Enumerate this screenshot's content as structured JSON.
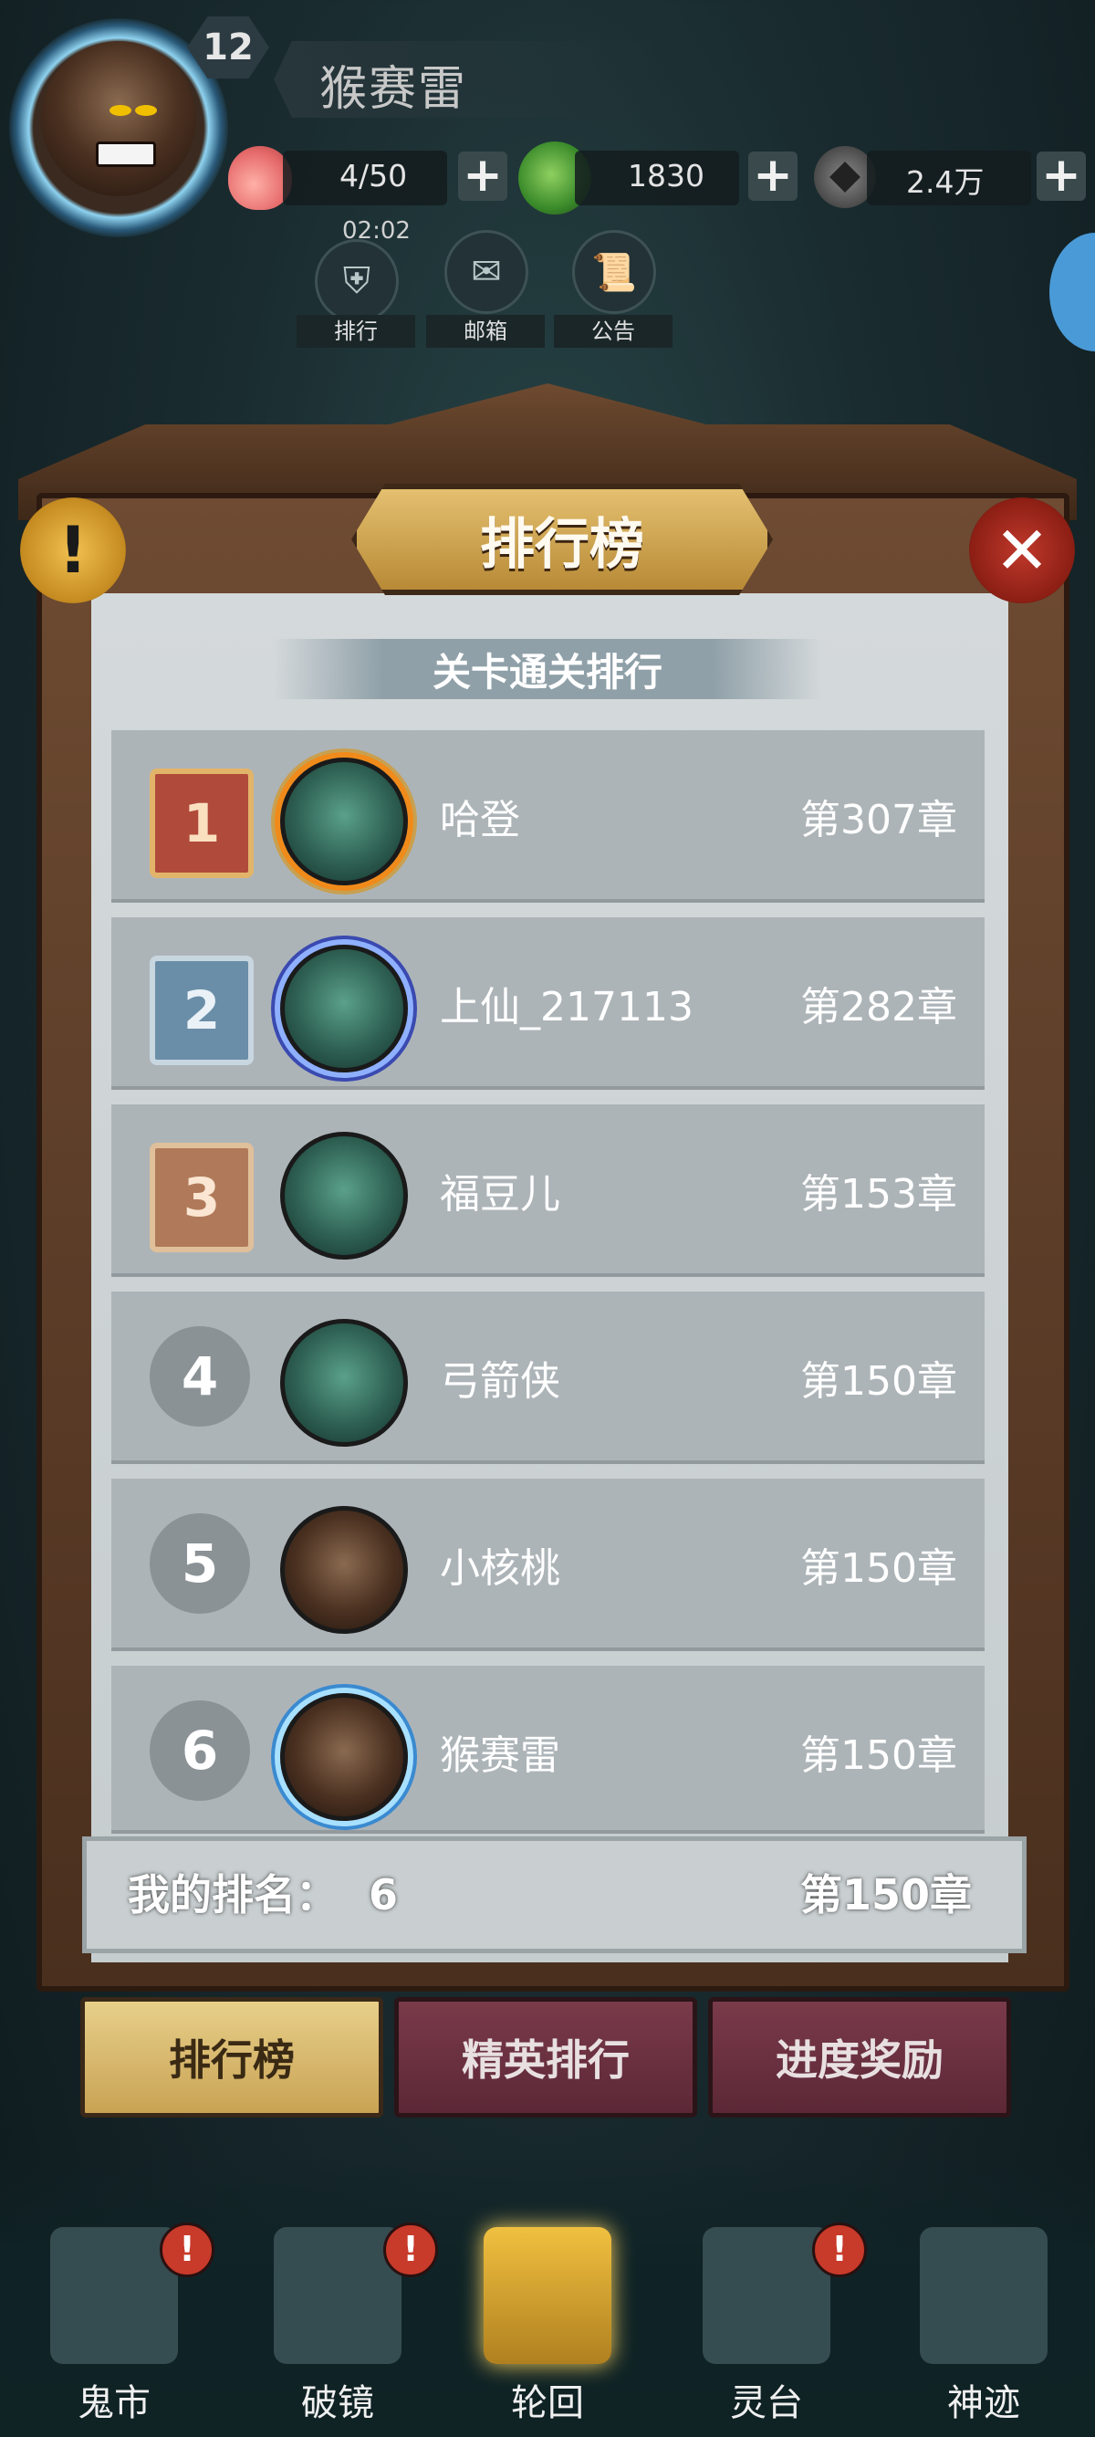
{
  "player": {
    "level": "12",
    "name": "猴赛雷"
  },
  "resources": {
    "stamina": "4/50",
    "jade": "1830",
    "coins": "2.4万"
  },
  "shortcuts": {
    "timer": "02:02",
    "items": [
      {
        "label": "排行",
        "icon": "armor-icon"
      },
      {
        "label": "邮箱",
        "icon": "mail-icon"
      },
      {
        "label": "公告",
        "icon": "scroll-icon"
      }
    ]
  },
  "panel": {
    "title": "排行榜",
    "subtitle": "关卡通关排行",
    "rows": [
      {
        "rank": "1",
        "name": "哈登",
        "chapter": "第307章"
      },
      {
        "rank": "2",
        "name": "上仙_217113",
        "chapter": "第282章"
      },
      {
        "rank": "3",
        "name": "福豆儿",
        "chapter": "第153章"
      },
      {
        "rank": "4",
        "name": "弓箭侠",
        "chapter": "第150章"
      },
      {
        "rank": "5",
        "name": "小核桃",
        "chapter": "第150章"
      },
      {
        "rank": "6",
        "name": "猴赛雷",
        "chapter": "第150章"
      }
    ],
    "my_rank_label": "我的排名：",
    "my_rank_value": "6",
    "my_chapter": "第150章"
  },
  "tabs": {
    "leaderboard": "排行榜",
    "elite": "精英排行",
    "progress": "进度奖励"
  },
  "nav": [
    {
      "label": "鬼市",
      "badge": "!"
    },
    {
      "label": "破镜",
      "badge": "!"
    },
    {
      "label": "轮回",
      "badge": ""
    },
    {
      "label": "灵台",
      "badge": "!"
    },
    {
      "label": "神迹",
      "badge": ""
    }
  ],
  "colors": {
    "accent_gold": "#c9a354",
    "tab_inactive": "#5c2836",
    "close_red": "#c0392b"
  }
}
